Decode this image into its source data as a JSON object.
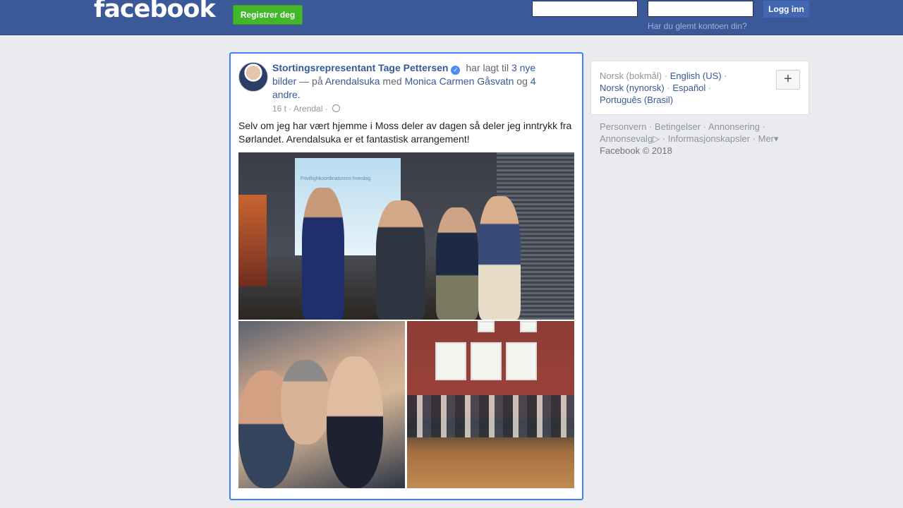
{
  "header": {
    "logo": "facebook",
    "register_label": "Registrer deg",
    "email_value": "",
    "password_value": "",
    "login_label": "Logg inn",
    "forgot_label": "Har du glemt kontoen din?"
  },
  "post": {
    "author": "Stortingsrepresentant Tage Pettersen",
    "verified_icon": "✓",
    "action_text": " har lagt til ",
    "photos_link": "3 nye bilder",
    "at_text": " — på ",
    "event_link": "Arendalsuka",
    "with_text": " med ",
    "tagged_link": "Monica Carmen Gåsvatn",
    "and_text": " og ",
    "others_link": "4 andre.",
    "time": "16 t",
    "separator": " · ",
    "location": "Arendal",
    "separator2": " · ",
    "body": "Selv om jeg har vært hjemme i Moss deler av dagen så deler jeg inntrykk fra Sørlandet. Arendalsuka er et fantastisk arrangement!",
    "screen_text": "Frivillighkoordinatorens hverdag"
  },
  "languages": {
    "current": "Norsk (bokmål)",
    "items": [
      "English (US)",
      "Norsk (nynorsk)",
      "Español",
      "Português (Brasil)"
    ],
    "sep": " · "
  },
  "footer": {
    "links": [
      "Personvern",
      "Betingelser",
      "Annonsering",
      "Annonsevalg",
      "Informasjonskapsler",
      "Mer"
    ],
    "sep": " · ",
    "adchoices_icon": "▷",
    "more_icon": "▾",
    "copyright": "Facebook © 2018"
  }
}
